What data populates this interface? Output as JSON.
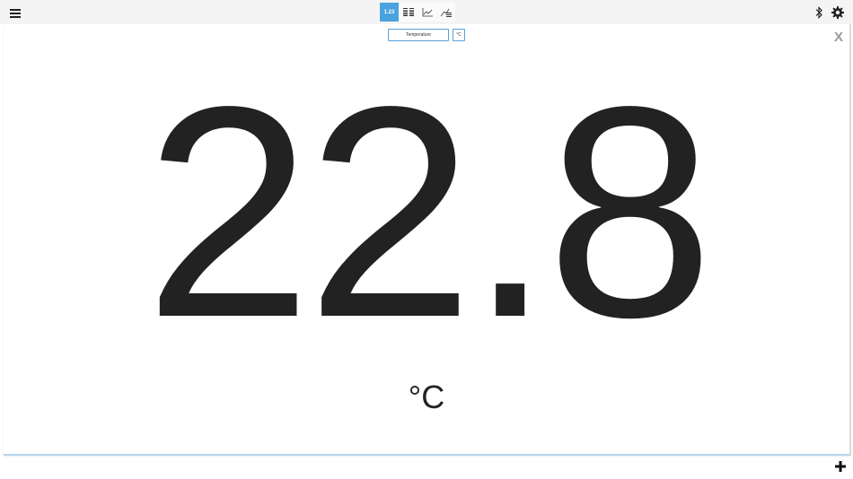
{
  "toolbar": {
    "menu_icon": "hamburger-menu-icon",
    "tabs": [
      {
        "label": "1.23",
        "icon": "digits-icon",
        "active": true
      },
      {
        "label": "",
        "icon": "table-icon",
        "active": false
      },
      {
        "label": "",
        "icon": "graph-icon",
        "active": false
      },
      {
        "label": "",
        "icon": "graph-table-icon",
        "active": false
      }
    ],
    "bluetooth_icon": "bluetooth-icon",
    "settings_icon": "gear-icon"
  },
  "panel": {
    "sensor_select": "Temperature",
    "unit_select": "°C",
    "close_label": "X",
    "value": "22.8",
    "unit": "°C"
  },
  "footer": {
    "add_icon": "plus-icon"
  },
  "colors": {
    "accent": "#4aa3df",
    "text": "#222222",
    "topbar": "#f4f4f4"
  }
}
